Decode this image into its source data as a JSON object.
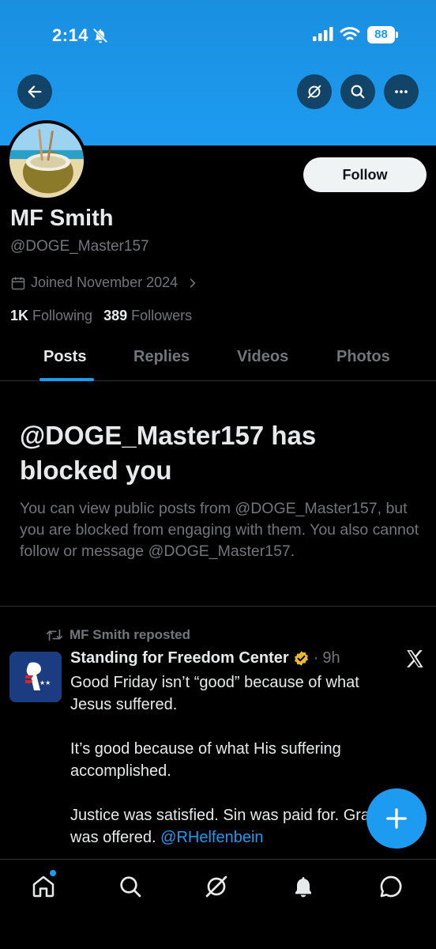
{
  "status_bar": {
    "time": "2:14",
    "battery": "88"
  },
  "profile": {
    "display_name": "MF Smith",
    "handle": "@DOGE_Master157",
    "joined": "Joined November 2024",
    "following_count": "1K",
    "following_label": "Following",
    "followers_count": "389",
    "followers_label": "Followers",
    "follow_button": "Follow"
  },
  "tabs": [
    {
      "label": "Posts",
      "active": true
    },
    {
      "label": "Replies",
      "active": false
    },
    {
      "label": "Videos",
      "active": false
    },
    {
      "label": "Photos",
      "active": false
    }
  ],
  "blocked": {
    "title": "@DOGE_Master157 has blocked you",
    "description": "You can view public posts from @DOGE_Master157, but you are blocked from engaging with them. You also cannot follow or message @DOGE_Master157."
  },
  "post": {
    "repost_label": "MF Smith reposted",
    "author": "Standing for Freedom Center",
    "time": "9h",
    "separator": "·",
    "body": [
      "Good Friday isn’t “good” because of what Jesus suffered.",
      "It’s good because of what His suffering accomplished.",
      "Justice was satisfied. Sin was paid for. Grace was offered."
    ],
    "mention": "@RHelfenbein"
  },
  "colors": {
    "accent": "#1d9bf0",
    "background": "#000000",
    "muted": "#71767b",
    "verified": "#e8b830"
  },
  "icons": [
    "back-arrow-icon",
    "grok-icon",
    "search-icon",
    "more-icon",
    "bell-off-icon",
    "signal-icon",
    "wifi-icon",
    "calendar-icon",
    "chevron-right-icon",
    "repost-icon",
    "verified-badge-icon",
    "x-logo-icon",
    "compose-plus-icon",
    "home-icon",
    "explore-search-icon",
    "grok-nav-icon",
    "notifications-icon",
    "messages-icon"
  ]
}
